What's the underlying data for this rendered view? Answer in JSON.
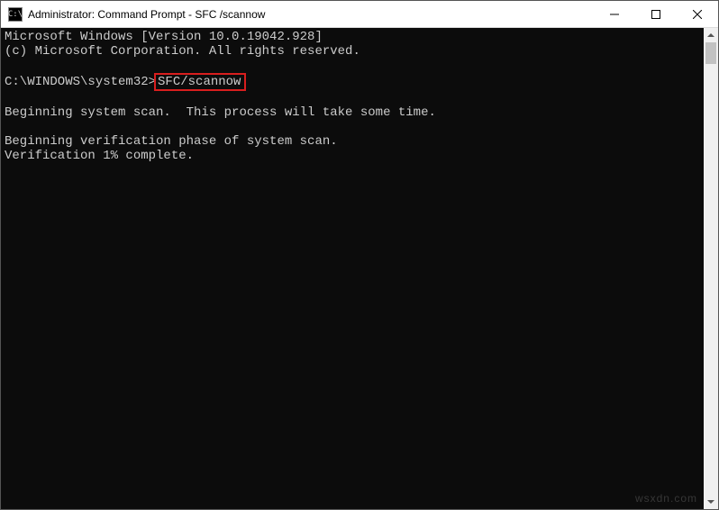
{
  "window": {
    "title": "Administrator: Command Prompt - SFC /scannow",
    "icon_glyph": "C:\\"
  },
  "terminal": {
    "line1": "Microsoft Windows [Version 10.0.19042.928]",
    "line2": "(c) Microsoft Corporation. All rights reserved.",
    "blank1": "",
    "prompt": "C:\\WINDOWS\\system32>",
    "command": "SFC/scannow",
    "blank2": "",
    "scan_line": "Beginning system scan.  This process will take some time.",
    "blank3": "",
    "verify1": "Beginning verification phase of system scan.",
    "verify2": "Verification 1% complete."
  },
  "watermark": "wsxdn.com"
}
